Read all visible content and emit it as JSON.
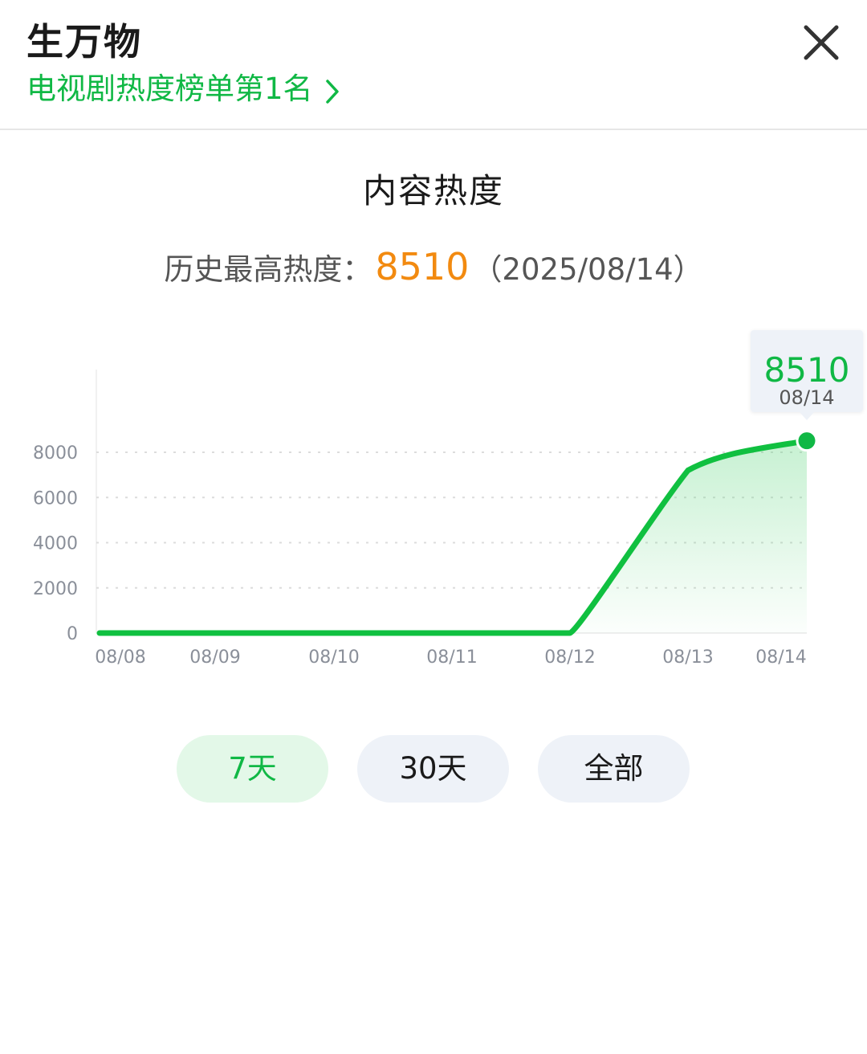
{
  "header": {
    "title": "生万物",
    "rank_link": "电视剧热度榜单第1名"
  },
  "section": {
    "title": "内容热度",
    "history_prefix": "历史最高热度：",
    "history_peak": "8510",
    "history_date": "（2025/08/14）"
  },
  "chart_data": {
    "type": "area",
    "x": [
      "08/08",
      "08/09",
      "08/10",
      "08/11",
      "08/12",
      "08/13",
      "08/14"
    ],
    "values": [
      0,
      0,
      0,
      0,
      0,
      7200,
      8510
    ],
    "yticks": [
      "8000",
      "6000",
      "4000",
      "2000",
      "0"
    ],
    "ylim": [
      0,
      8000
    ],
    "grid": true,
    "line_color": "#10c040",
    "tooltip": {
      "value": "8510",
      "date": "08/14"
    }
  },
  "range_selector": {
    "options": [
      {
        "label": "7天",
        "active": true
      },
      {
        "label": "30天",
        "active": false
      },
      {
        "label": "全部",
        "active": false
      }
    ]
  },
  "colors": {
    "accent": "#10b845",
    "peak": "#f28a10"
  }
}
